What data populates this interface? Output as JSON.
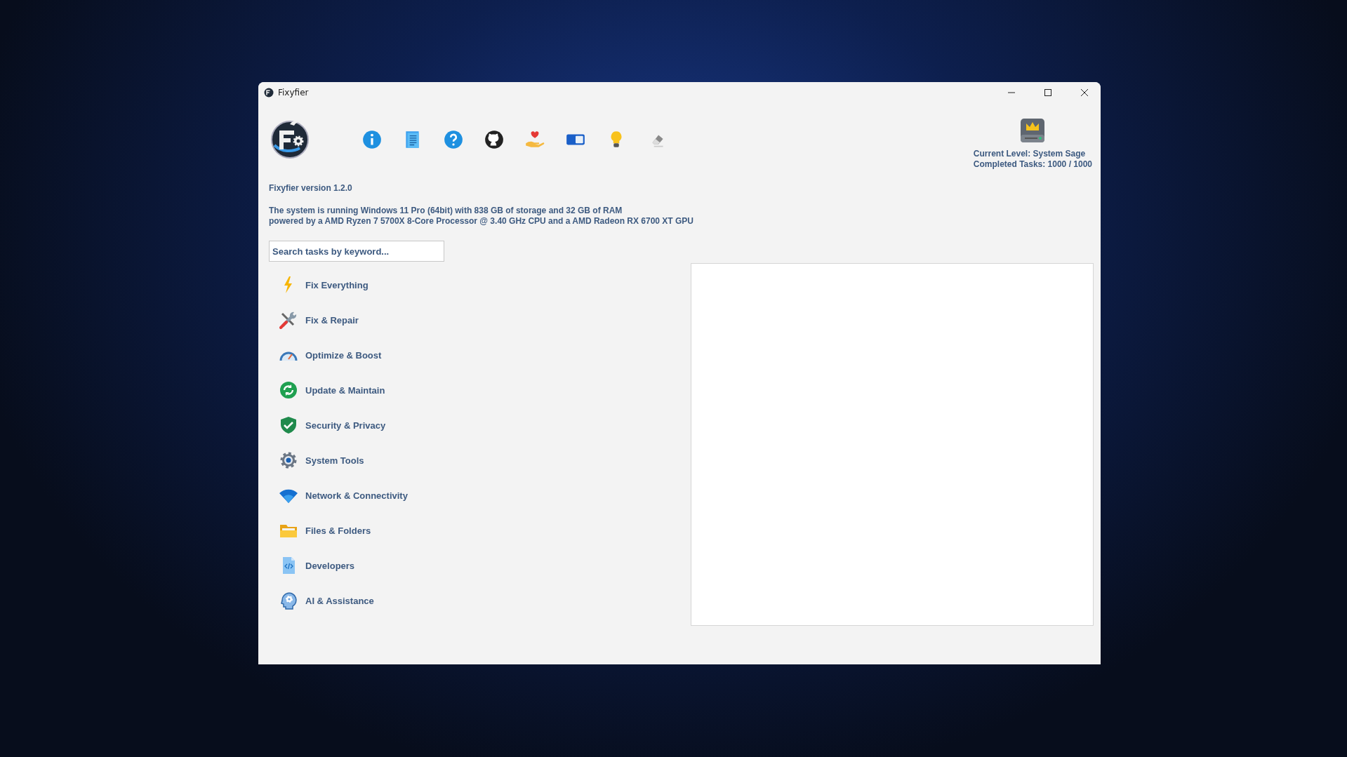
{
  "window": {
    "title": "Fixyfier"
  },
  "version": "Fixyfier version 1.2.0",
  "system_info": [
    "The system is running Windows 11 Pro (64bit) with 838 GB of storage and 32 GB of RAM",
    "powered by a AMD Ryzen 7 5700X 8-Core Processor @ 3.40 GHz CPU and a AMD Radeon RX 6700 XT GPU"
  ],
  "level": {
    "current": "Current Level: System Sage",
    "completed": "Completed Tasks: 1000 / 1000"
  },
  "search": {
    "placeholder": "Search tasks by keyword..."
  },
  "categories": [
    {
      "label": "Fix Everything"
    },
    {
      "label": "Fix & Repair"
    },
    {
      "label": "Optimize & Boost"
    },
    {
      "label": "Update & Maintain"
    },
    {
      "label": "Security & Privacy"
    },
    {
      "label": "System Tools"
    },
    {
      "label": "Network & Connectivity"
    },
    {
      "label": "Files & Folders"
    },
    {
      "label": "Developers"
    },
    {
      "label": "AI & Assistance"
    }
  ]
}
